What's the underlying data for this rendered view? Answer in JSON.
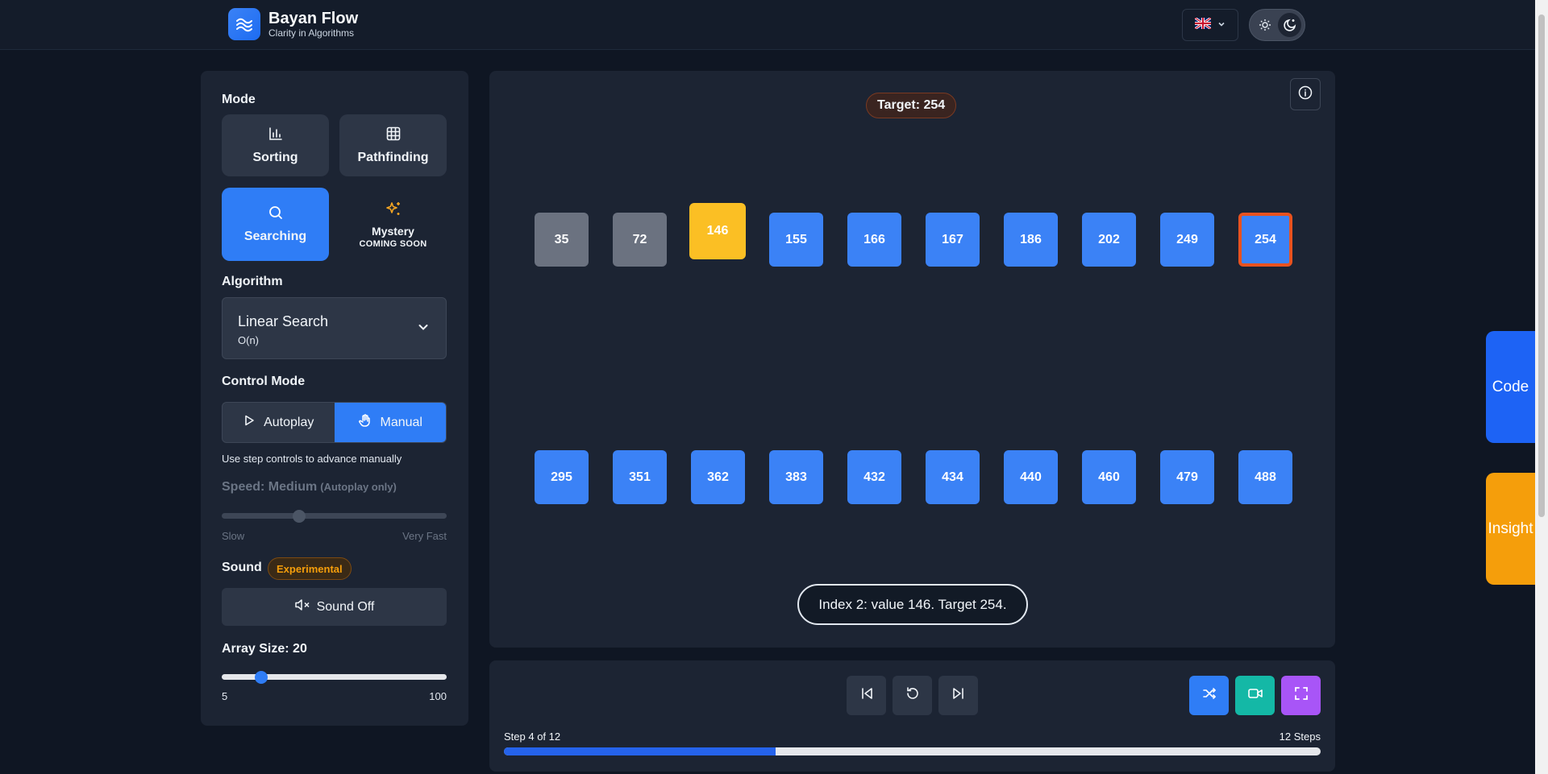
{
  "header": {
    "app_title": "Bayan Flow",
    "app_subtitle": "Clarity in Algorithms",
    "language_flag": "🇬🇧"
  },
  "sidebar": {
    "mode_title": "Mode",
    "modes": [
      {
        "label": "Sorting",
        "icon": "bar-chart-icon",
        "active": false
      },
      {
        "label": "Pathfinding",
        "icon": "grid-icon",
        "active": false
      },
      {
        "label": "Searching",
        "icon": "search-icon",
        "active": true
      },
      {
        "label": "Mystery",
        "icon": "sparkles-icon",
        "badge": "COMING SOON",
        "active": false
      }
    ],
    "algorithm_title": "Algorithm",
    "algorithm": {
      "name": "Linear Search",
      "complexity": "O(n)"
    },
    "control_mode_title": "Control Mode",
    "control_modes": [
      {
        "label": "Autoplay",
        "icon": "play-icon",
        "active": false
      },
      {
        "label": "Manual",
        "icon": "hand-icon",
        "active": true
      }
    ],
    "control_hint": "Use step controls to advance manually",
    "speed": {
      "label": "Speed: Medium",
      "note": "(Autoplay only)",
      "min_label": "Slow",
      "max_label": "Very Fast",
      "value_fraction": 0.34
    },
    "sound": {
      "title": "Sound",
      "badge": "Experimental",
      "button_label": "Sound Off"
    },
    "array_size": {
      "label": "Array Size: 20",
      "min": "5",
      "max": "100",
      "value": 20
    }
  },
  "visualization": {
    "target_label": "Target: 254",
    "row1": [
      {
        "value": "35",
        "state": "visited"
      },
      {
        "value": "72",
        "state": "visited"
      },
      {
        "value": "146",
        "state": "current"
      },
      {
        "value": "155",
        "state": "default"
      },
      {
        "value": "166",
        "state": "default"
      },
      {
        "value": "167",
        "state": "default"
      },
      {
        "value": "186",
        "state": "default"
      },
      {
        "value": "202",
        "state": "default"
      },
      {
        "value": "249",
        "state": "default"
      },
      {
        "value": "254",
        "state": "target"
      }
    ],
    "row2": [
      {
        "value": "295",
        "state": "default"
      },
      {
        "value": "351",
        "state": "default"
      },
      {
        "value": "362",
        "state": "default"
      },
      {
        "value": "383",
        "state": "default"
      },
      {
        "value": "432",
        "state": "default"
      },
      {
        "value": "434",
        "state": "default"
      },
      {
        "value": "440",
        "state": "default"
      },
      {
        "value": "460",
        "state": "default"
      },
      {
        "value": "479",
        "state": "default"
      },
      {
        "value": "488",
        "state": "default"
      }
    ],
    "status_message": "Index 2: value 146. Target 254."
  },
  "controls": {
    "step_label": "Step 4 of 12",
    "total_steps": "12 Steps",
    "progress": 0.333,
    "buttons": [
      "step-back-icon",
      "reset-icon",
      "step-forward-icon",
      "shuffle-icon",
      "video-icon",
      "fullscreen-icon"
    ]
  },
  "side_tabs": {
    "code": "Code",
    "insight": "Insight"
  },
  "colors": {
    "accent": "#2f7df6",
    "current": "#fbbf24",
    "visited": "#6b7280",
    "target_border": "#e8521f",
    "insight": "#f59e0b",
    "video": "#14b8a6",
    "fullscreen": "#a855f7"
  }
}
